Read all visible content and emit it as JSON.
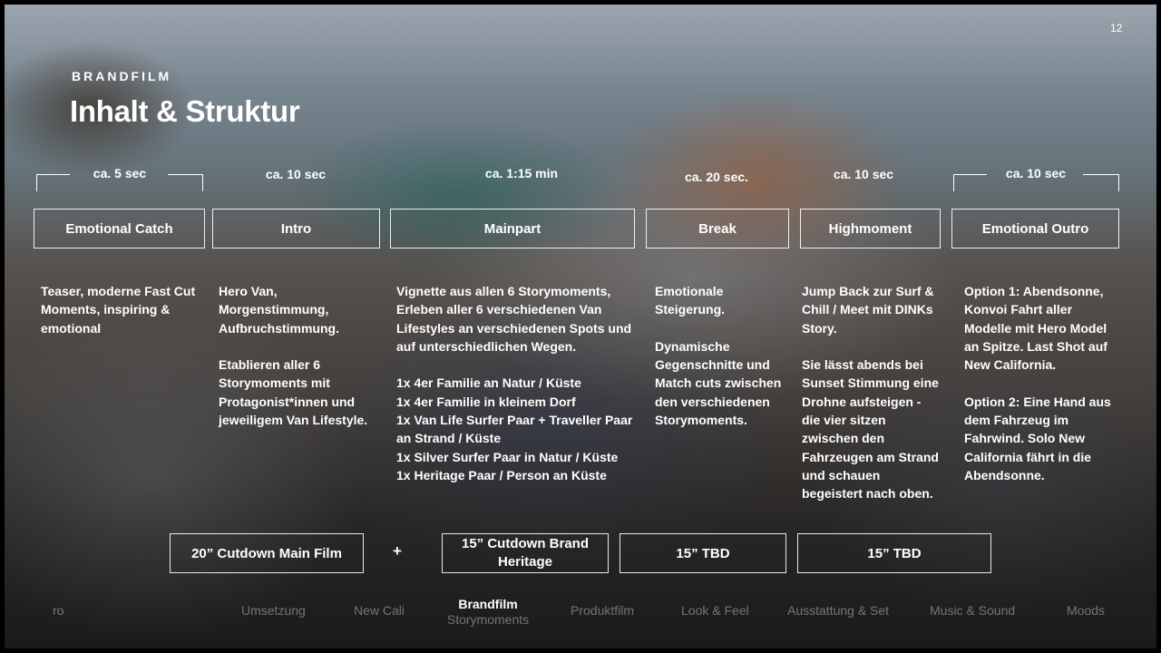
{
  "slide": {
    "page_number": "12",
    "eyebrow": "BRANDFILM",
    "title": "Inhalt & Struktur"
  },
  "timings": [
    "ca. 5 sec",
    "ca. 10 sec",
    "ca. 1:15 min",
    "ca. 20 sec.",
    "ca. 10 sec",
    "ca. 10 sec"
  ],
  "sections": [
    "Emotional Catch",
    "Intro",
    "Mainpart",
    "Break",
    "Highmoment",
    "Emotional Outro"
  ],
  "descriptions": {
    "catch": [
      "Teaser, moderne Fast Cut Moments, inspiring & emotional"
    ],
    "intro": [
      "Hero Van, Morgenstimmung, Aufbruchstimmung.",
      "Etablieren aller 6 Storymoments mit Protagonist*innen und jeweiligem Van Lifestyle."
    ],
    "mainpart": [
      "Vignette aus allen 6 Storymoments, Erleben aller 6 verschiedenen Van Lifestyles an verschiedenen Spots und auf unterschiedlichen Wegen.",
      "1x 4er Familie an Natur / Küste",
      "1x 4er Familie in kleinem Dorf",
      "1x Van Life Surfer Paar + Traveller Paar an Strand / Küste",
      "1x Silver Surfer Paar in Natur / Küste",
      "1x Heritage Paar / Person an Küste"
    ],
    "break": [
      "Emotionale Steigerung.",
      "Dynamische Gegenschnitte und Match cuts zwischen den verschiedenen Storymoments."
    ],
    "highmoment": [
      "Jump Back zur Surf & Chill / Meet mit DINKs Story.",
      "Sie lässt abends bei Sunset Stimmung eine Drohne aufsteigen - die vier sitzen zwischen den Fahrzeugen am Strand und schauen begeistert nach oben."
    ],
    "outro": [
      "Option 1: Abendsonne, Konvoi Fahrt aller Modelle mit Hero Model an Spitze. Last Shot auf New California.",
      "Option 2: Eine Hand aus dem Fahrzeug im Fahrwind. Solo New California fährt in die Abendsonne."
    ]
  },
  "cutdowns": [
    "20” Cutdown Main Film",
    "+",
    "15” Cutdown Brand Heritage",
    "15” TBD",
    "15” TBD"
  ],
  "nav": {
    "items": [
      "ro",
      "Umsetzung",
      "New Cali",
      "Brandfilm",
      "Produktfilm",
      "Look & Feel",
      "Ausstattung & Set",
      "Music & Sound",
      "Moods"
    ],
    "active_sub": "Storymoments"
  },
  "colors": {
    "text": "#ffffff",
    "nav_inactive": "rgba(255,255,255,0.38)"
  }
}
